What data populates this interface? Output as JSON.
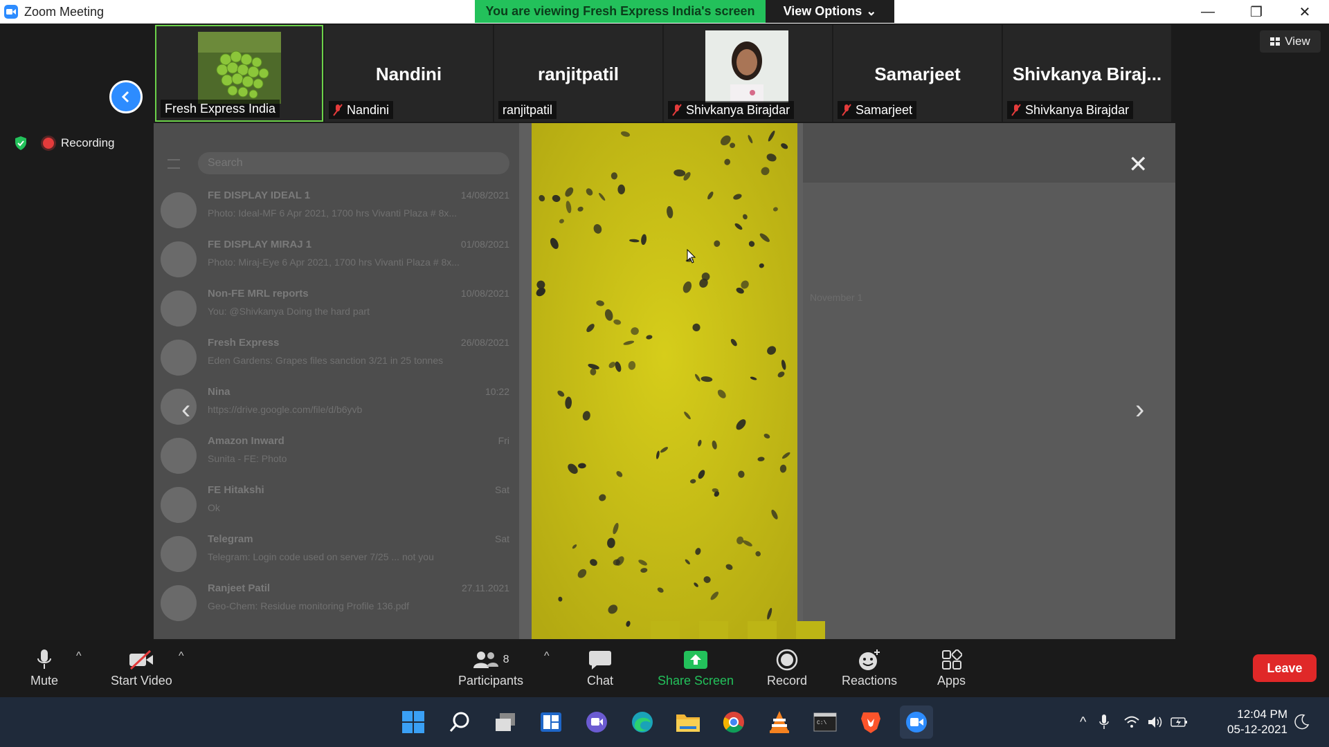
{
  "window": {
    "title": "Zoom Meeting"
  },
  "banner": {
    "text": "You are viewing Fresh Express India's screen"
  },
  "view_options": {
    "label": "View Options"
  },
  "view_button": {
    "label": "View"
  },
  "recording": {
    "label": "Recording"
  },
  "participants_strip": [
    {
      "big_name": "",
      "label": "Fresh Express India",
      "muted": false,
      "has_photo": true
    },
    {
      "big_name": "Nandini",
      "label": "Nandini",
      "muted": true,
      "has_photo": false
    },
    {
      "big_name": "ranjitpatil",
      "label": "ranjitpatil",
      "muted": false,
      "has_photo": false
    },
    {
      "big_name": "",
      "label": "Shivkanya Birajdar",
      "muted": true,
      "has_photo": true
    },
    {
      "big_name": "Samarjeet",
      "label": "Samarjeet",
      "muted": true,
      "has_photo": false
    },
    {
      "big_name": "Shivkanya  Biraj...",
      "label": "Shivkanya Birajdar",
      "muted": true,
      "has_photo": false
    }
  ],
  "shared_screen": {
    "search_placeholder": "Search",
    "chats": [
      {
        "name": "FE DISPLAY IDEAL 1",
        "date": "14/08/2021",
        "preview": "Photo: Ideal-MF 6 Apr 2021, 1700 hrs Vivanti Plaza # 8x..."
      },
      {
        "name": "FE DISPLAY MIRAJ 1",
        "date": "01/08/2021",
        "preview": "Photo: Miraj-Eye 6 Apr 2021, 1700 hrs Vivanti Plaza # 8x..."
      },
      {
        "name": "Non-FE MRL reports",
        "date": "10/08/2021",
        "preview": "You: @Shivkanya Doing the hard part"
      },
      {
        "name": "Fresh Express",
        "date": "26/08/2021",
        "preview": "Eden Gardens: Grapes files sanction 3/21 in 25 tonnes"
      },
      {
        "name": "Nina",
        "date": "10:22",
        "preview": "https://drive.google.com/file/d/b6yvb"
      },
      {
        "name": "Amazon Inward",
        "date": "Fri",
        "preview": "Sunita - FE: Photo"
      },
      {
        "name": "FE Hitakshi",
        "date": "Sat",
        "preview": "Ok"
      },
      {
        "name": "Telegram",
        "date": "Sat",
        "preview": "Telegram: Login code used on server 7/25 ... not you"
      },
      {
        "name": "Ranjeet Patil",
        "date": "27.11.2021",
        "preview": "Geo-Chem: Residue monitoring Profile 136.pdf"
      }
    ],
    "november_label": "November 1"
  },
  "toolbar": {
    "mute": "Mute",
    "start_video": "Start Video",
    "participants": "Participants",
    "participants_count": "8",
    "chat": "Chat",
    "share_screen": "Share Screen",
    "record": "Record",
    "reactions": "Reactions",
    "apps": "Apps",
    "leave": "Leave"
  },
  "taskbar": {
    "time": "12:04 PM",
    "date": "05-12-2021"
  },
  "colors": {
    "accent_blue": "#2d8cff",
    "green": "#23c15b",
    "leave_red": "#e02828",
    "sticky_trap_yellow": "#c5bd13"
  }
}
